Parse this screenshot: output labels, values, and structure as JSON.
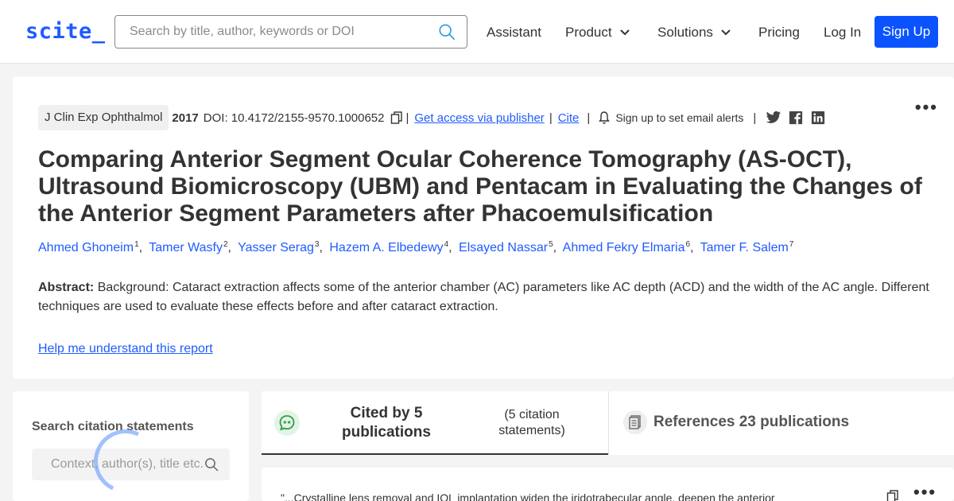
{
  "header": {
    "logo": "scite_",
    "search_placeholder": "Search by title, author, keywords or DOI",
    "nav": {
      "assistant": "Assistant",
      "product": "Product",
      "solutions": "Solutions",
      "pricing": "Pricing",
      "login": "Log In",
      "signup": "Sign Up"
    }
  },
  "article": {
    "journal": "J Clin Exp Ophthalmol",
    "year": "2017",
    "doi": "DOI: 10.4172/2155-9570.1000652",
    "access_link": "Get access via publisher",
    "cite_link": "Cite",
    "alerts": "Sign up to set email alerts",
    "title": "Comparing Anterior Segment Ocular Coherence Tomography (AS-OCT), Ultrasound Biomicroscopy (UBM) and Pentacam in Evaluating the Changes of the Anterior Segment Parameters after Phacoemulsification",
    "authors": [
      {
        "name": "Ahmed Ghoneim",
        "sup": "1"
      },
      {
        "name": "Tamer Wasfy",
        "sup": "2"
      },
      {
        "name": "Yasser Serag",
        "sup": "3"
      },
      {
        "name": "Hazem A. Elbedewy",
        "sup": "4"
      },
      {
        "name": "Elsayed Nassar",
        "sup": "5"
      },
      {
        "name": "Ahmed Fekry Elmaria",
        "sup": "6"
      },
      {
        "name": "Tamer F. Salem",
        "sup": "7"
      }
    ],
    "abstract_label": "Abstract:",
    "abstract_text": "Background: Cataract extraction affects some of the anterior chamber (AC) parameters like AC depth (ACD) and the width of the AC angle. Different techniques are used to evaluate these effects before and after cataract extraction.",
    "help_link": "Help me understand this report"
  },
  "citations": {
    "search_title": "Search citation statements",
    "search_placeholder": "Context, author(s), title etc.",
    "cited_by": "Cited by 5 publications",
    "cited_statements": "(5 citation statements)",
    "references": "References 23 publications",
    "snippet": "\"...Crystalline lens removal and IOL implantation widen the iridotrabecular angle, deepen the anterior"
  },
  "colors": {
    "accent": "#1f5cff",
    "signup_bg": "#0a53ff"
  }
}
